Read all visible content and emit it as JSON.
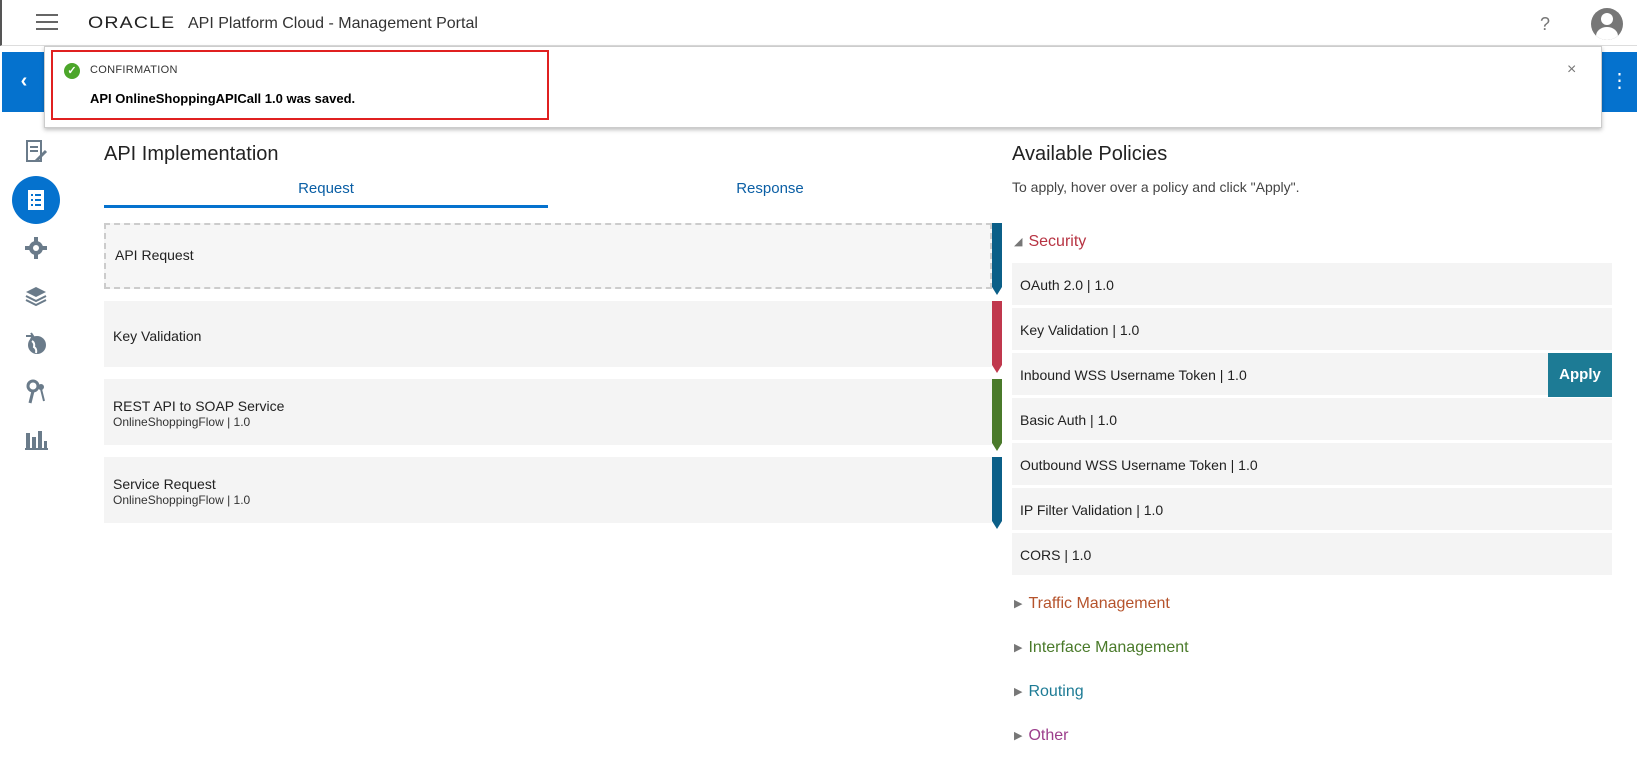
{
  "header": {
    "logo_text": "ORACLE",
    "app_title": "API Platform Cloud - Management Portal",
    "help_label": "?"
  },
  "nav": {
    "back_glyph": "‹",
    "more_glyph": "⋮"
  },
  "banner": {
    "type_label": "CONFIRMATION",
    "message": "API OnlineShoppingAPICall 1.0 was saved.",
    "close_glyph": "×"
  },
  "left_nav": {
    "icons": [
      "document-edit-icon",
      "implementation-icon",
      "gear-icon",
      "layers-icon",
      "globe-icon",
      "keys-icon",
      "analytics-icon"
    ],
    "active_index": 1
  },
  "implementation": {
    "title": "API Implementation",
    "tabs": [
      {
        "label": "Request",
        "active": true
      },
      {
        "label": "Response",
        "active": false
      }
    ],
    "flow": [
      {
        "label": "API Request",
        "sub": "",
        "color": "#0b5f88"
      },
      {
        "label": "Key Validation",
        "sub": "",
        "color": "#c0384d"
      },
      {
        "label": "REST API to SOAP Service",
        "sub": "OnlineShoppingFlow | 1.0",
        "color": "#4a7a2a"
      },
      {
        "label": "Service Request",
        "sub": "OnlineShoppingFlow | 1.0",
        "color": "#0b5f88"
      }
    ]
  },
  "policies": {
    "title": "Available Policies",
    "hint": "To apply, hover over a policy and click \"Apply\".",
    "apply_label": "Apply",
    "groups": [
      {
        "name": "Security",
        "expanded": true,
        "color": "#b73342",
        "items": [
          "OAuth 2.0 | 1.0",
          "Key Validation | 1.0",
          "Inbound WSS Username Token | 1.0",
          "Basic Auth | 1.0",
          "Outbound WSS Username Token | 1.0",
          "IP Filter Validation | 1.0",
          "CORS | 1.0"
        ]
      },
      {
        "name": "Traffic Management",
        "expanded": false,
        "color": "#b5532c"
      },
      {
        "name": "Interface Management",
        "expanded": false,
        "color": "#4a7a2a"
      },
      {
        "name": "Routing",
        "expanded": false,
        "color": "#1d7b95"
      },
      {
        "name": "Other",
        "expanded": false,
        "color": "#9c3e8c"
      }
    ]
  }
}
